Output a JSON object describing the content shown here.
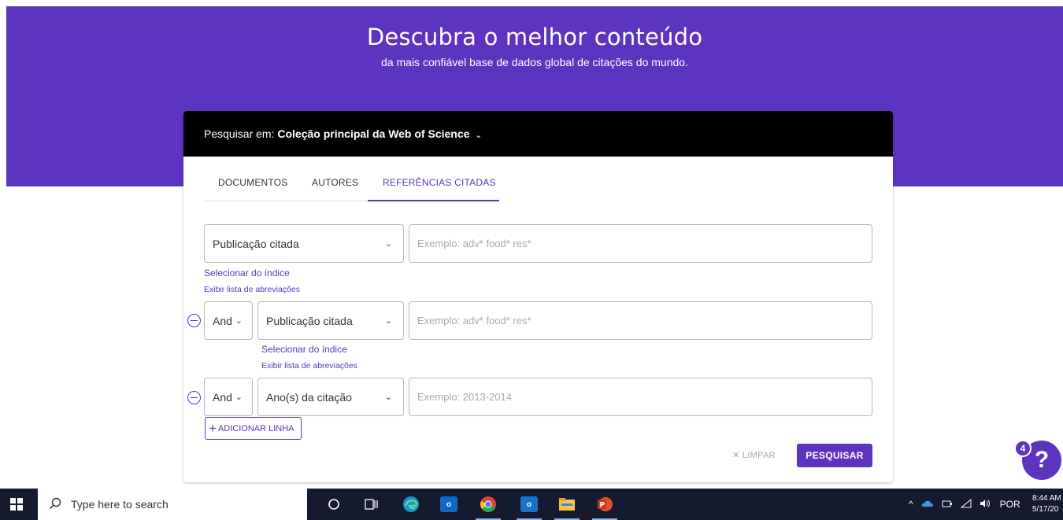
{
  "hero": {
    "title": "Descubra o melhor conteúdo",
    "subtitle": "da mais confiável base de dados global de citações do mundo."
  },
  "search_scope": {
    "label": "Pesquisar em:",
    "value": "Coleção principal da Web of Science",
    "caret": "⌄"
  },
  "tabs": [
    {
      "label": "DOCUMENTOS",
      "active": false
    },
    {
      "label": "AUTORES",
      "active": false
    },
    {
      "label": "REFERÊNCIAS CITADAS",
      "active": true
    }
  ],
  "rows": [
    {
      "field": "Publicação citada",
      "placeholder": "Exemplo: adv* food* res*",
      "link_index": "Selecionar do índice",
      "link_abbrev": "Exibir lista de abreviações"
    },
    {
      "operator": "And",
      "field": "Publicação citada",
      "placeholder": "Exemplo: adv* food* res*",
      "link_index": "Selecionar do índice",
      "link_abbrev": "Exibir lista de abreviações"
    },
    {
      "operator": "And",
      "field": "Ano(s) da citação",
      "placeholder": "Exemplo: 2013-2014"
    }
  ],
  "buttons": {
    "add_row": "ADICIONAR LINHA",
    "clear": "LIMPAR",
    "search": "PESQUISAR"
  },
  "help": {
    "badge": "4",
    "symbol": "?"
  },
  "taskbar": {
    "search_placeholder": "Type here to search",
    "language": "POR",
    "time": "8:44 AM",
    "date": "5/17/20",
    "apps": [
      "cortana-icon",
      "task-view-icon",
      "edge-icon",
      "outlook-icon",
      "chrome-icon",
      "outlook-mail-icon",
      "file-explorer-icon",
      "powerpoint-icon"
    ]
  },
  "colors": {
    "brand_purple": "#5c34c0",
    "header_black": "#000000",
    "taskbar": "#151a2f"
  }
}
